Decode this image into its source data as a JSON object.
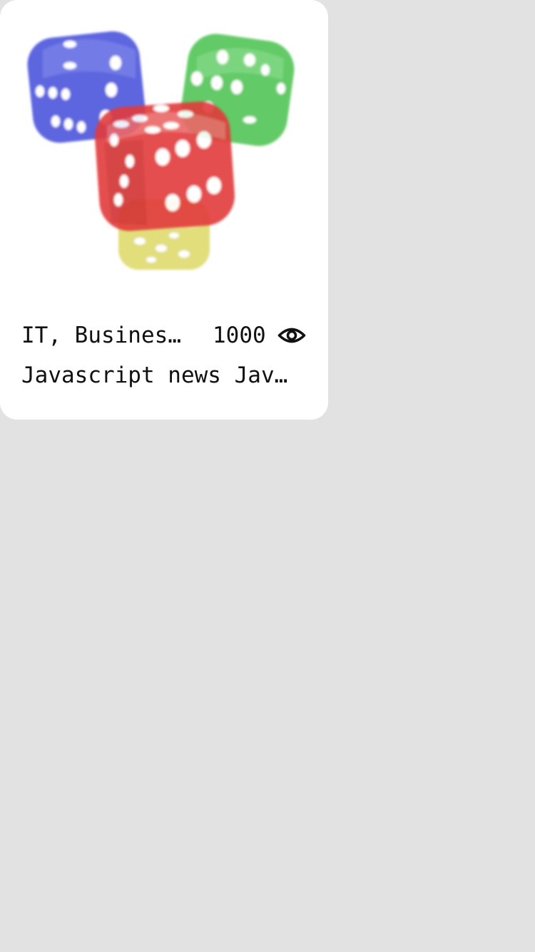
{
  "card": {
    "image_icon": "dice-image",
    "category": "IT, Business, Technology",
    "views": "1000",
    "views_icon": "eye-icon",
    "title": "Javascript news Javascript news"
  },
  "colors": {
    "background": "#e2e2e2",
    "card": "#ffffff",
    "text": "#111111",
    "die_blue": "#3a44d8",
    "die_green": "#3fbf45",
    "die_red": "#e23b3b",
    "die_yellow": "#d6d24a"
  }
}
